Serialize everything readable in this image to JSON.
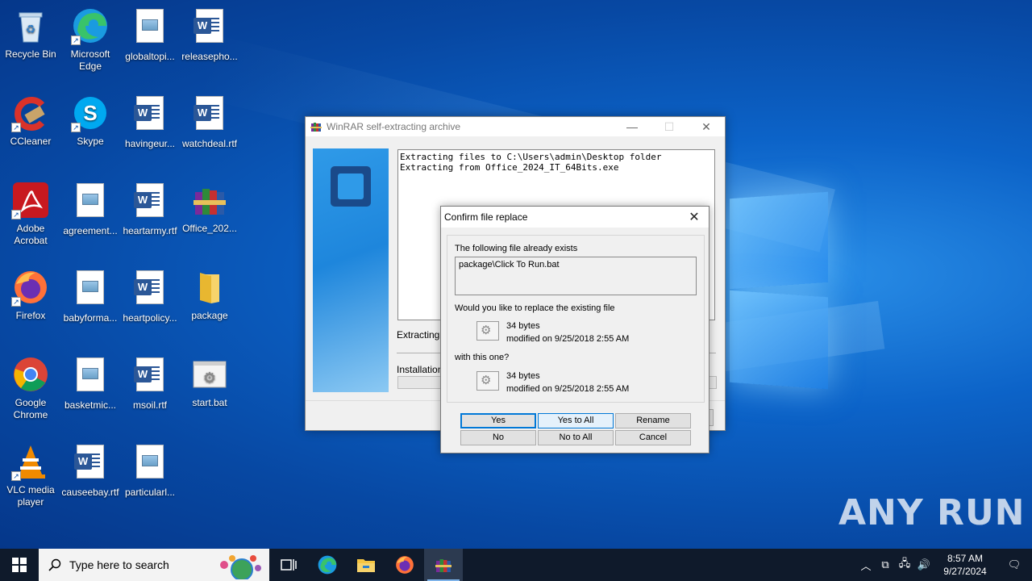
{
  "desktop": {
    "icons": [
      {
        "label": "Recycle Bin"
      },
      {
        "label": "Microsoft Edge"
      },
      {
        "label": "globaltopi..."
      },
      {
        "label": "releasepho..."
      },
      {
        "label": "CCleaner"
      },
      {
        "label": "Skype"
      },
      {
        "label": "havingeur..."
      },
      {
        "label": "watchdeal.rtf"
      },
      {
        "label": "Adobe Acrobat"
      },
      {
        "label": "agreement..."
      },
      {
        "label": "heartarmy.rtf"
      },
      {
        "label": "Office_202..."
      },
      {
        "label": "Firefox"
      },
      {
        "label": "babyforma..."
      },
      {
        "label": "heartpolicy..."
      },
      {
        "label": "package"
      },
      {
        "label": "Google Chrome"
      },
      {
        "label": "basketmic..."
      },
      {
        "label": "msoil.rtf"
      },
      {
        "label": "start.bat"
      },
      {
        "label": "VLC media player"
      },
      {
        "label": "causeebay.rtf"
      },
      {
        "label": "particularl..."
      }
    ],
    "watermark": "ANY RUN"
  },
  "sfx_window": {
    "title": "WinRAR self-extracting archive",
    "log_line1": "Extracting files to C:\\Users\\admin\\Desktop folder",
    "log_line2": "Extracting from Office_2024_IT_64Bits.exe",
    "extracting_label": "Extracting p",
    "installation_label": "Installation"
  },
  "confirm_dialog": {
    "title": "Confirm file replace",
    "exists_text": "The following file already exists",
    "file_path": "package\\Click To Run.bat",
    "replace_question": "Would you like to replace the existing file",
    "existing_size": "34 bytes",
    "existing_modified": "modified on 9/25/2018 2:55 AM",
    "with_this": "with this one?",
    "new_size": "34 bytes",
    "new_modified": "modified on 9/25/2018 2:55 AM",
    "buttons": {
      "yes": "Yes",
      "yes_to_all": "Yes to All",
      "rename": "Rename",
      "no": "No",
      "no_to_all": "No to All",
      "cancel": "Cancel"
    }
  },
  "taskbar": {
    "search_placeholder": "Type here to search",
    "time": "8:57 AM",
    "date": "9/27/2024"
  }
}
